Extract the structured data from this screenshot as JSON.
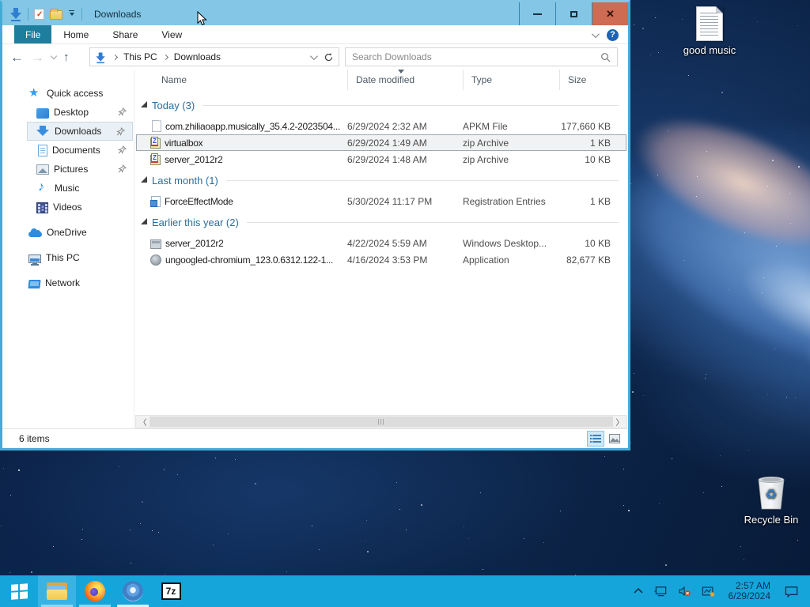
{
  "colors": {
    "titlebar": "#83c6e5",
    "window_border": "#44abd7",
    "taskbar": "#16a5db",
    "close_button": "#ce6b53",
    "file_tab": "#1e7e9e",
    "group_header_text": "#2a6d9b",
    "selection_border": "#9fa8ae"
  },
  "window": {
    "title": "Downloads",
    "ribbon": {
      "tabs": [
        "File",
        "Home",
        "Share",
        "View"
      ]
    },
    "nav": {
      "breadcrumb": [
        "This PC",
        "Downloads"
      ],
      "search_placeholder": "Search Downloads"
    },
    "columns": [
      "Name",
      "Date modified",
      "Type",
      "Size"
    ],
    "sort": {
      "column": "Date modified",
      "direction": "descending"
    },
    "sidebar": [
      {
        "label": "Quick access",
        "icon": "star",
        "level": 0
      },
      {
        "label": "Desktop",
        "icon": "desktop",
        "level": 1,
        "pinned": true
      },
      {
        "label": "Downloads",
        "icon": "downloads",
        "level": 1,
        "pinned": true,
        "selected": true
      },
      {
        "label": "Documents",
        "icon": "doc",
        "level": 1,
        "pinned": true
      },
      {
        "label": "Pictures",
        "icon": "pic",
        "level": 1,
        "pinned": true
      },
      {
        "label": "Music",
        "icon": "music",
        "level": 1
      },
      {
        "label": "Videos",
        "icon": "video",
        "level": 1
      },
      {
        "label": "OneDrive",
        "icon": "cloud",
        "level": 0,
        "gap": true
      },
      {
        "label": "This PC",
        "icon": "pc",
        "level": 0,
        "gap": true
      },
      {
        "label": "Network",
        "icon": "net",
        "level": 0,
        "gap": true
      }
    ],
    "groups": [
      {
        "label": "Today (3)",
        "files": [
          {
            "name": "com.zhiliaoapp.musically_35.4.2-2023504...",
            "date": "6/29/2024 2:32 AM",
            "type": "APKM File",
            "size": "177,660 KB",
            "icon": "file"
          },
          {
            "name": "virtualbox",
            "date": "6/29/2024 1:49 AM",
            "type": "zip Archive",
            "size": "1 KB",
            "icon": "zip",
            "selected": true
          },
          {
            "name": "server_2012r2",
            "date": "6/29/2024 1:48 AM",
            "type": "zip Archive",
            "size": "10 KB",
            "icon": "zip"
          }
        ]
      },
      {
        "label": "Last month (1)",
        "files": [
          {
            "name": "ForceEffectMode",
            "date": "5/30/2024 11:17 PM",
            "type": "Registration Entries",
            "size": "1 KB",
            "icon": "reg"
          }
        ]
      },
      {
        "label": "Earlier this year (2)",
        "files": [
          {
            "name": "server_2012r2",
            "date": "4/22/2024 5:59 AM",
            "type": "Windows Desktop...",
            "size": "10 KB",
            "icon": "rdp"
          },
          {
            "name": "ungoogled-chromium_123.0.6312.122-1...",
            "date": "4/16/2024 3:53 PM",
            "type": "Application",
            "size": "82,677 KB",
            "icon": "app"
          }
        ]
      }
    ],
    "statusbar": {
      "items_text": "6 items"
    }
  },
  "desktop": {
    "icons": [
      {
        "label": "good music",
        "type": "text-document"
      },
      {
        "label": "Recycle Bin",
        "type": "recycle-bin"
      }
    ]
  },
  "taskbar": {
    "apps": [
      "start-button",
      "file-explorer",
      "firefox",
      "chromium",
      "7zip"
    ],
    "tray_icons": [
      "tray-expand-chevron",
      "network-icon",
      "volume-muted-icon",
      "security-icon",
      "action-center-icon"
    ],
    "clock": {
      "time": "2:57 AM",
      "date": "6/29/2024"
    }
  }
}
